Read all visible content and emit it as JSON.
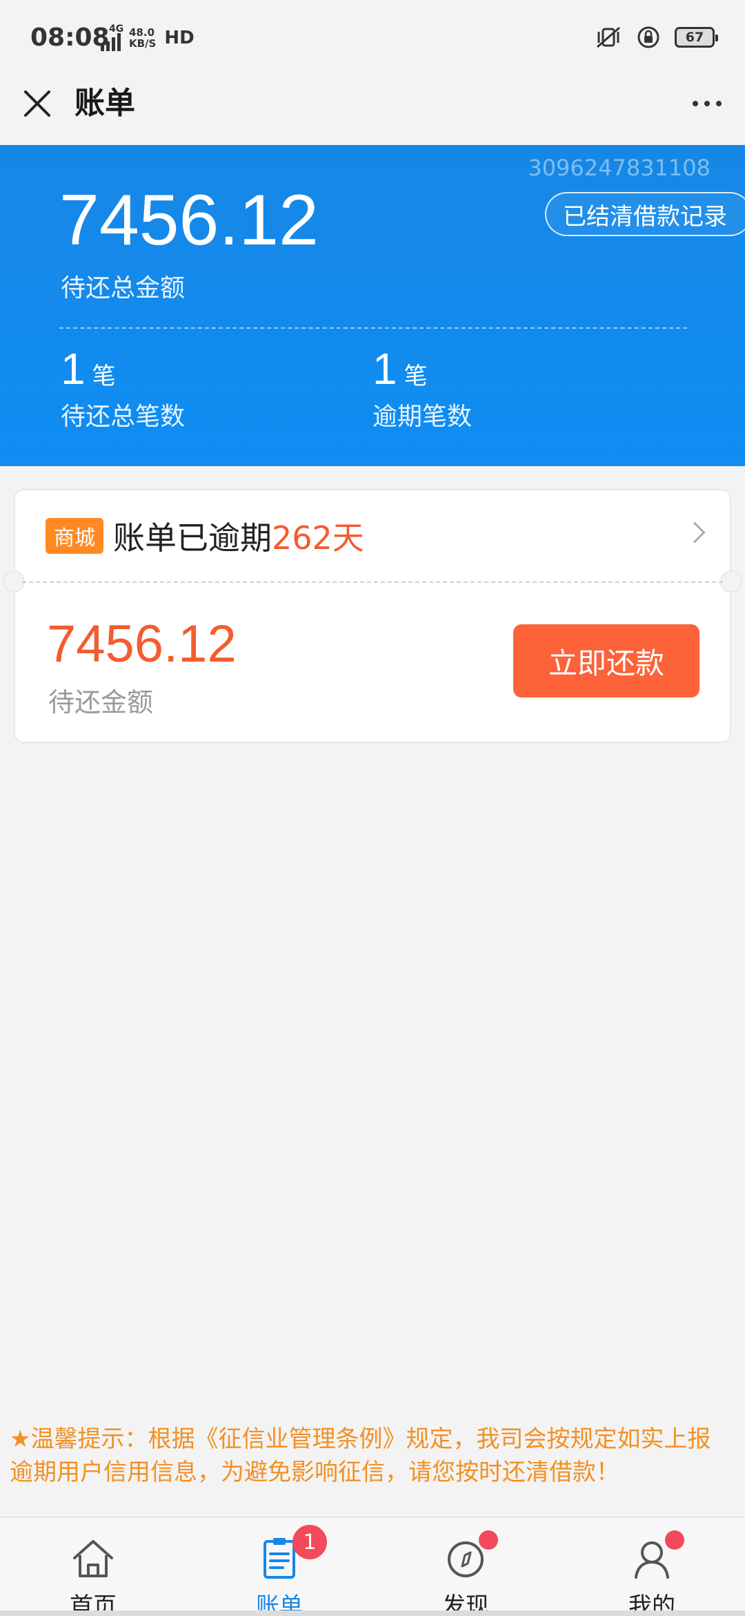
{
  "status_bar": {
    "time": "08:08",
    "network": "4G",
    "speed_value": "48.0",
    "speed_unit": "KB/S",
    "hd": "HD",
    "battery": "67"
  },
  "header": {
    "title": "账单",
    "close_icon": "close-icon",
    "more_icon": "more-icon"
  },
  "summary": {
    "account_id": "3096247831108",
    "settled_records_label": "已结清借款记录",
    "total_amount": "7456.12",
    "total_label": "待还总金额",
    "pending_count": "1",
    "pending_unit": "笔",
    "pending_label": "待还总笔数",
    "overdue_count": "1",
    "overdue_unit": "笔",
    "overdue_label": "逾期笔数",
    "color": "#1787e5"
  },
  "bill": {
    "tag": "商城",
    "status_text": "账单已逾期",
    "overdue_days": "262天",
    "amount": "7456.12",
    "amount_label": "待还金额",
    "pay_label": "立即还款",
    "accent_color": "#f25c2f",
    "tag_color": "#ff8a24"
  },
  "notice": {
    "text": "★温馨提示：根据《征信业管理条例》规定，我司会按规定如实上报逾期用户信用信息，为避免影响征信，请您按时还清借款！"
  },
  "bottom_nav": {
    "items": [
      {
        "label": "首页",
        "icon": "home-icon",
        "active": false
      },
      {
        "label": "账单",
        "icon": "bill-icon",
        "active": true,
        "badge": "1"
      },
      {
        "label": "发现",
        "icon": "compass-icon",
        "active": false
      },
      {
        "label": "我的",
        "icon": "user-icon",
        "active": false
      }
    ]
  }
}
